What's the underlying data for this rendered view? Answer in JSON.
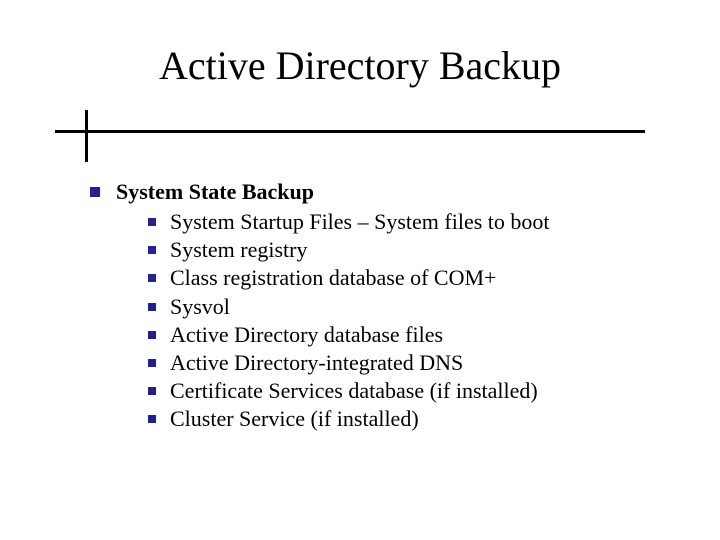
{
  "title": "Active Directory Backup",
  "main": {
    "heading": "System State Backup",
    "items": [
      "System Startup Files – System files to boot",
      "System registry",
      "Class registration database of COM+",
      "Sysvol",
      "Active Directory database files",
      "Active Directory-integrated DNS",
      "Certificate Services database (if installed)",
      "Cluster Service (if installed)"
    ]
  }
}
